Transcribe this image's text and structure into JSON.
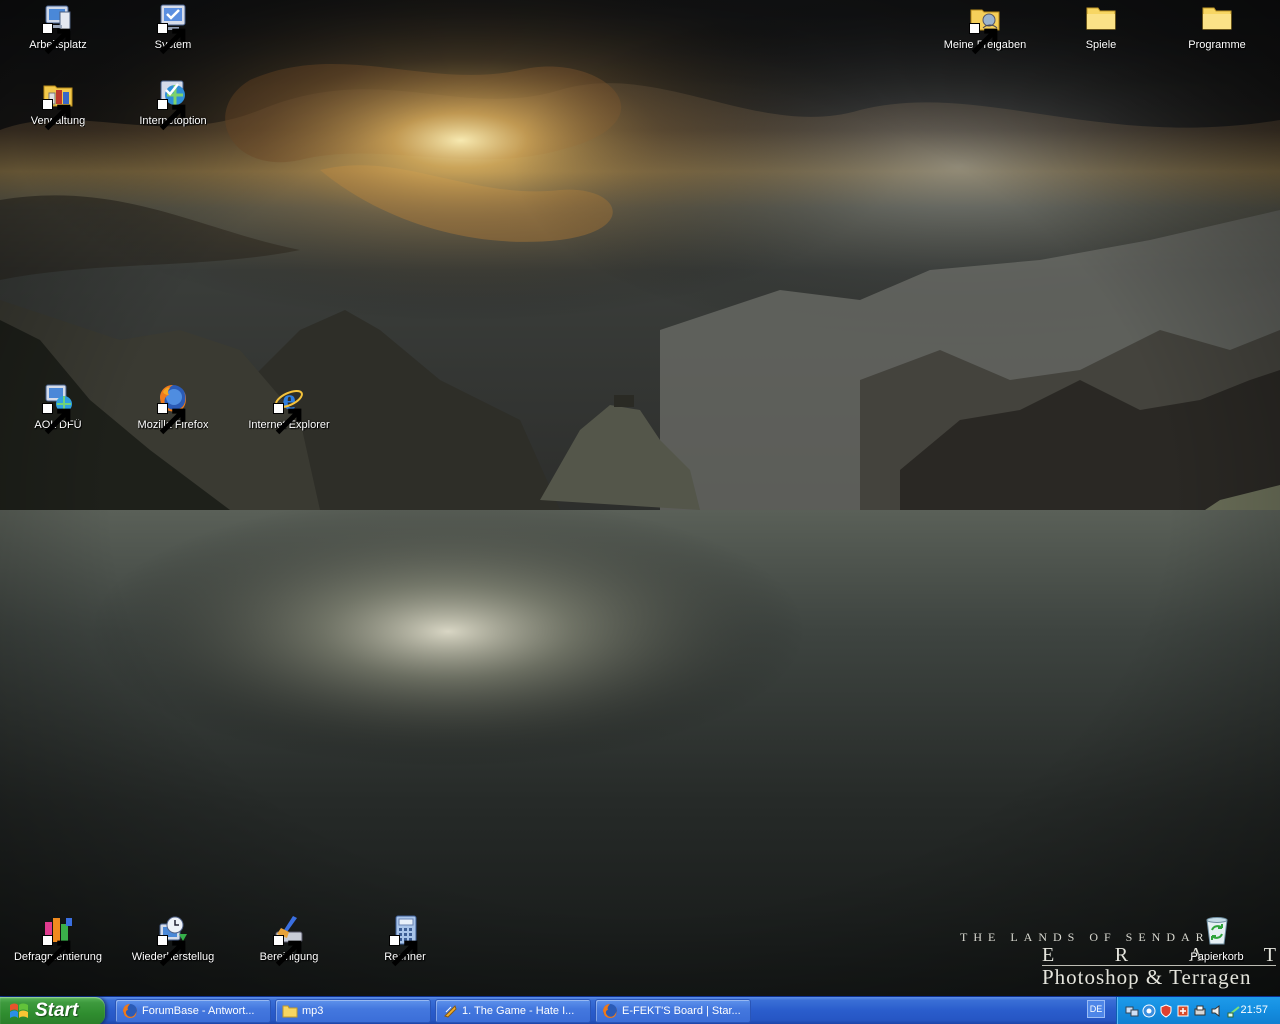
{
  "desktop": {
    "icons": [
      {
        "label": "Arbeitsplatz",
        "icon": "my-computer-icon"
      },
      {
        "label": "System",
        "icon": "system-properties-icon"
      },
      {
        "label": "Verwaltung",
        "icon": "administrative-tools-icon"
      },
      {
        "label": "Internetoption",
        "icon": "internet-options-icon"
      },
      {
        "label": "Meine Freigaben",
        "icon": "shared-folder-icon"
      },
      {
        "label": "Spiele",
        "icon": "folder-icon"
      },
      {
        "label": "Programme",
        "icon": "folder-icon"
      },
      {
        "label": "AOL DFÜ",
        "icon": "aol-dialup-icon"
      },
      {
        "label": "Mozilla Firefox",
        "icon": "firefox-icon"
      },
      {
        "label": "Internet Explorer",
        "icon": "internet-explorer-icon"
      },
      {
        "label": "Defragmentierung",
        "icon": "defragmenter-icon"
      },
      {
        "label": "Wiederherstellug",
        "icon": "system-restore-icon"
      },
      {
        "label": "Bereinigung",
        "icon": "disk-cleanup-icon"
      },
      {
        "label": "Rechner",
        "icon": "calculator-icon"
      },
      {
        "label": "Papierkorb",
        "icon": "recycle-bin-icon"
      }
    ]
  },
  "wallpaper": {
    "line1": "THE LANDS OF SENDAR",
    "line2_letters": [
      "E",
      "R",
      "A",
      "T"
    ],
    "line3": "Photoshop & Terragen"
  },
  "taskbar": {
    "start_label": "Start",
    "tasks": [
      {
        "label": "ForumBase - Antwort...",
        "icon": "firefox-icon"
      },
      {
        "label": "mp3",
        "icon": "folder-icon"
      },
      {
        "label": "1. The Game - Hate I...",
        "icon": "winamp-icon"
      },
      {
        "label": "E-FEKT'S Board | Star...",
        "icon": "firefox-icon"
      }
    ],
    "language": "DE",
    "tray_icons": [
      "network-icon",
      "messenger-icon",
      "security-icon",
      "antivirus-icon",
      "printer-icon",
      "volume-icon",
      "connection-icon"
    ],
    "clock": "21:57"
  },
  "colors": {
    "taskbar_blue": "#2a5dcc",
    "start_green": "#3e9a3e",
    "tray_blue": "#1590e2"
  }
}
